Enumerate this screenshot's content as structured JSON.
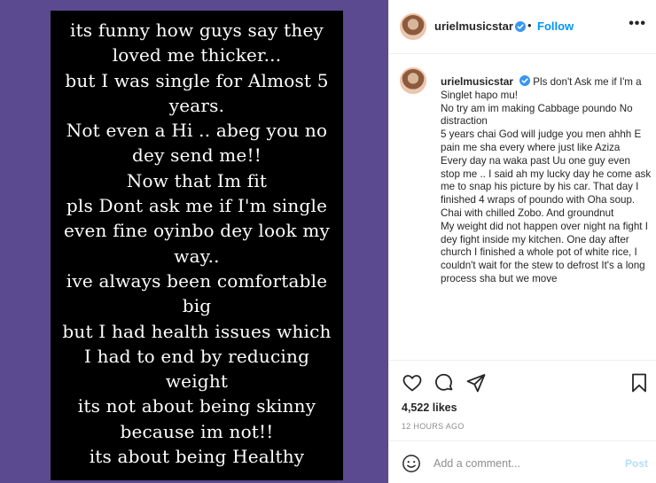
{
  "media": {
    "background_color": "#5b4a8f",
    "card_color": "#000000",
    "story_lines": [
      "its funny how guys say they",
      "loved me thicker...",
      "but I was single for Almost 5",
      "years.",
      "Not even a Hi .. abeg you no",
      "dey send me!!",
      "Now that Im fit",
      "pls Dont ask me if I'm single",
      "even fine oyinbo dey look my",
      "way..",
      "ive always been comfortable",
      "big",
      "but I had health issues which",
      "I had to end by reducing",
      "weight",
      "its not about being skinny",
      "because im not!!",
      "its about being Healthy"
    ]
  },
  "header": {
    "username": "urielmusicstar",
    "dot": "•",
    "follow_label": "Follow",
    "more_icon": "more-horizontal-icon",
    "more_label": "•••"
  },
  "caption": {
    "username": "urielmusicstar",
    "lines": [
      "Pls don't Ask me if I'm a Singlet hapo mu!",
      "No try am im making Cabbage poundo No distraction",
      "5 years chai God will judge you men ahhh E pain me sha every where just like Aziza",
      "Every day na waka past Uu one guy even stop me .. I said ah my lucky day he come ask me to snap his picture by his car. That day I finished 4 wraps of poundo with Oha soup. Chai with chilled Zobo. And groundnut",
      "My weight did not happen over night na fight I dey fight inside my kitchen. One day after church I finished a whole pot of white rice, I couldn't wait for the stew to defrost It's a long process sha but we move"
    ]
  },
  "actions": {
    "icons": [
      "heart-icon",
      "comment-icon",
      "share-icon",
      "bookmark-icon"
    ]
  },
  "stats": {
    "likes": "4,522 likes",
    "time": "12 HOURS AGO"
  },
  "comment": {
    "placeholder": "Add a comment...",
    "post_label": "Post"
  },
  "colors": {
    "accent": "#0095f6",
    "post_disabled": "#b2dffc",
    "muted": "#8e8e8e"
  }
}
